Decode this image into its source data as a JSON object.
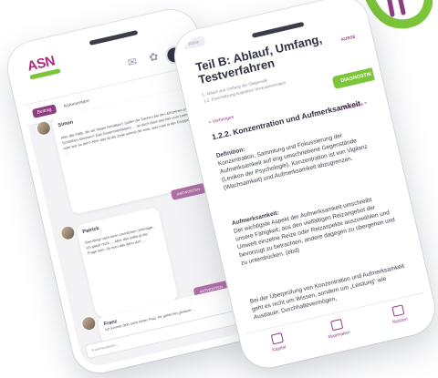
{
  "brand": {
    "colors": {
      "purple": "#8e3d82",
      "green": "#7cc43a",
      "magenta": "#b02a7a"
    }
  },
  "phone1": {
    "logo_text": "ASN",
    "tabs": [
      {
        "label": "Beitrag",
        "active": true
      },
      {
        "label": "Kommentare",
        "active": false
      }
    ],
    "messages": [
      {
        "author": "Simon",
        "text": "Also alle Fälle, die wir hinten hinhalten? Sollen die Sachen bei den Einzelnen pro Schreiben stimmen? Das Zusammenfassen … ist doch dass das hier vom Leiter oder wer so den? Aber das ist die Zeile einmal die eine, was man in der Gruppe hat …"
      },
      {
        "author": "Patrick",
        "text": "Das klingt nach einer ziemlichen Unterlage, ich glaub nicht … Aber das sollte ja die Frage sein, ob man das dann dort …"
      },
      {
        "author": "Franz",
        "text": "Ich konnte dich nicht hinter Frau. Ihr gehts bei genauer …"
      }
    ],
    "reply_label": "ANTWORTEN",
    "input_placeholder": "Kommentieren..."
  },
  "phone2": {
    "breadcrumb": "Kurse",
    "kurse_label": "KURSE",
    "title_line1": "Teil B: Ablauf, Umfang,",
    "title_line2": "Testverfahren",
    "subtitle_line1": "1. Ablauf und Umfang der Diagnostik",
    "subtitle_line2": "1.2. Einschätzung kognitiver Voraussetzungen",
    "diag_button": "DIAGNOSTIK",
    "back_label": "< Vorheriges",
    "next_label": "Nächstes >",
    "section_title": "1.2.2. Konzentration und Aufmerksamkeit",
    "definition_heading": "Definition:",
    "definition_text": "Konzentration, Sammlung und Fokussierung der Aufmerksamkeit auf eng umschriebene Gegenstände (Lexikon der Psychologie). Konzentration ist von Vigilanz (Wachsamkeit) und Aufmerksamkeit abzugrenzen.",
    "aufmerksamkeit_heading": "Aufmerksamkeit:",
    "aufmerksamkeit_text": "Der wichtigste Aspekt der Aufmerksamkeit umschreibt unsere Fähigkeit, aus den vielfältigen Reizangebot der Umwelt einzelne Reize oder Reizaspekte auszuwählen und bevorzugt zu betrachten, andere dagegen zu übergehen und zu unterdrücken. (ebd)",
    "footer_text": "Bei der Überprüfung von Konzentration und Aufmerksamkeit geht es nicht um Wissen, sondern um „Leistung“ wie Ausdauer, Durchhaltevermögen,",
    "nav": [
      {
        "label": "Kapitel",
        "icon": "book-icon"
      },
      {
        "label": "Materialien",
        "icon": "folder-icon"
      },
      {
        "label": "Notizen",
        "icon": "note-icon"
      }
    ]
  }
}
